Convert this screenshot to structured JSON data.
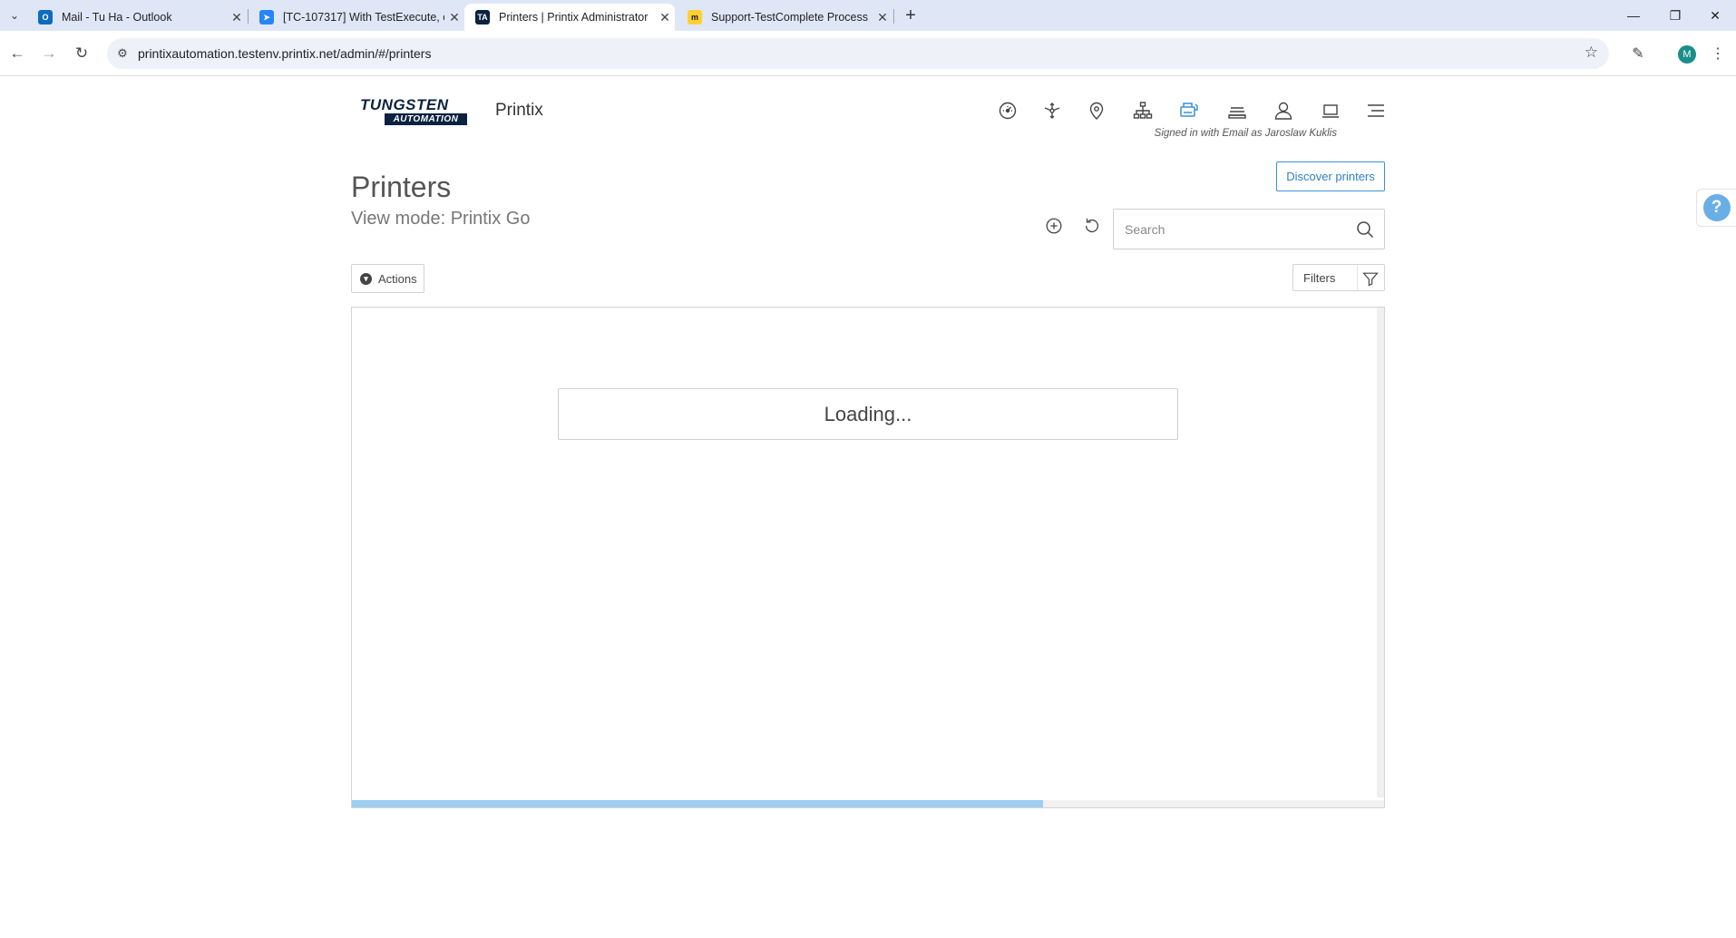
{
  "browser": {
    "tabs": [
      {
        "title": "Mail - Tu Ha - Outlook",
        "favicon": "outlook-icon",
        "active": false
      },
      {
        "title": "[TC-107317] With TestExecute, c",
        "favicon": "jira-icon",
        "active": false
      },
      {
        "title": "Printers | Printix Administrator",
        "favicon": "ta-icon",
        "active": true
      },
      {
        "title": "Support-TestComplete Process",
        "favicon": "miro-icon",
        "active": false
      }
    ],
    "url": "printixautomation.testenv.printix.net/admin/#/printers",
    "profile_initial": "M"
  },
  "header": {
    "logo_line1": "TUNGSTEN",
    "logo_line2": "AUTOMATION",
    "app_name": "Printix",
    "signed_in_text": "Signed in with Email as Jaroslaw Kuklis",
    "nav_icons": [
      "dashboard-icon",
      "network-icon",
      "location-icon",
      "hierarchy-icon",
      "printers-icon",
      "print-queues-icon",
      "user-icon",
      "computer-icon",
      "menu-icon"
    ],
    "active_nav": "printers-icon",
    "accent_color": "#2f7fc8"
  },
  "page": {
    "title": "Printers",
    "view_mode": "View mode: Printix Go",
    "discover_button": "Discover printers",
    "search_placeholder": "Search",
    "actions_label": "Actions",
    "filters_label": "Filters",
    "loading_text": "Loading...",
    "loading_progress": 0.67,
    "help_label": "?"
  }
}
